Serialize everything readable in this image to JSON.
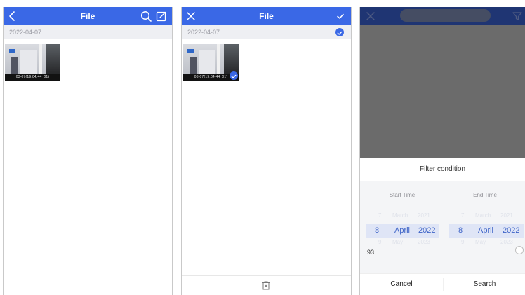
{
  "colors": {
    "accent": "#3a68e6",
    "dim_overlay": "#6b6b6b"
  },
  "screen_list": {
    "title": "File",
    "date_header": "2022-04-07",
    "icons": [
      "back-chevron-icon",
      "search-icon",
      "edit-icon"
    ],
    "thumbnail_caption": "03-07(19:04:44_01)"
  },
  "screen_select": {
    "title": "File",
    "date_header": "2022-04-07",
    "icons": [
      "close-icon",
      "confirm-check-icon",
      "delete-icon"
    ],
    "thumbnail_caption": "03-07(19:04:44_01)"
  },
  "screen_filter": {
    "search_placeholder": "",
    "sheet_title": "Filter condition",
    "start_time_label": "Start Time",
    "end_time_label": "End Time",
    "start_selected": {
      "day": "8",
      "month": "April",
      "year": "2022"
    },
    "end_selected": {
      "day": "8",
      "month": "April",
      "year": "2022"
    },
    "start_above": {
      "day": "7",
      "month": "March",
      "year": "2021"
    },
    "end_above": {
      "day": "7",
      "month": "March",
      "year": "2021"
    },
    "start_below": {
      "day": "9",
      "month": "May",
      "year": "2023"
    },
    "end_below": {
      "day": "9",
      "month": "May",
      "year": "2023"
    },
    "value_row_text": "93",
    "cancel_label": "Cancel",
    "search_label": "Search"
  }
}
